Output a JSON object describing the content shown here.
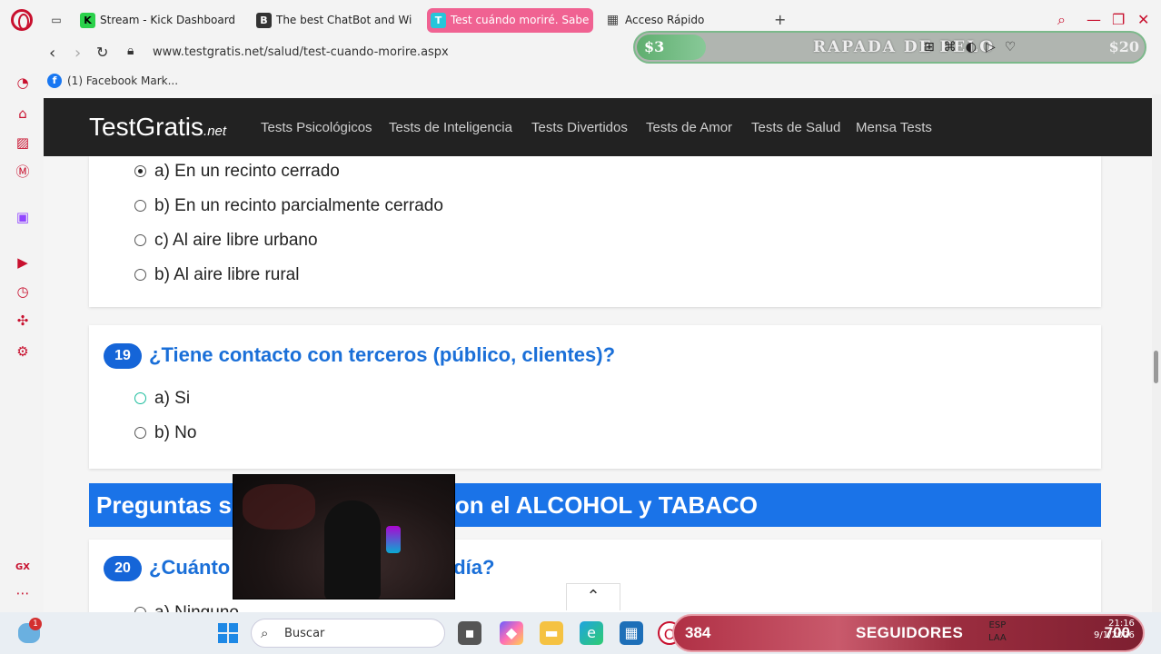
{
  "tabs": [
    {
      "label": "Stream - Kick Dashboard",
      "icon": "K"
    },
    {
      "label": "The best ChatBot and Wid",
      "icon": "B"
    },
    {
      "label": "Test cuándo moriré. Sabe",
      "icon": "T"
    },
    {
      "label": "Acceso Rápido",
      "icon": "grid"
    }
  ],
  "address": {
    "url": "www.testgratis.net/salud/test-cuando-morire.aspx"
  },
  "overlay": {
    "money": "$3",
    "title": "RAPADA DE PELO",
    "amount": "$20"
  },
  "bookmarks": [
    {
      "label": "(1) Facebook Mark..."
    }
  ],
  "site": {
    "brand": "TestGratis",
    "brand_suffix": ".net",
    "nav": [
      "Tests Psicológicos",
      "Tests de Inteligencia",
      "Tests Divertidos",
      "Tests de Amor",
      "Tests de Salud",
      "Mensa Tests"
    ]
  },
  "q18": {
    "options": [
      {
        "text": "a) En un recinto cerrado",
        "checked": true
      },
      {
        "text": "b) En un recinto parcialmente cerrado",
        "checked": false
      },
      {
        "text": "c) Al aire libre urbano",
        "checked": false
      },
      {
        "text": "b) Al aire libre rural",
        "checked": false
      }
    ]
  },
  "q19": {
    "number": "19",
    "question": "¿Tiene contacto con terceros (público, clientes)?",
    "options": [
      {
        "text": "a) Si",
        "checked": false
      },
      {
        "text": "b) No",
        "checked": false
      }
    ]
  },
  "section": {
    "title_start": "Preguntas s",
    "title_end": "on el ALCOHOL y TABACO"
  },
  "q20": {
    "number": "20",
    "question_start": "¿Cuánto",
    "question_end": "día?",
    "option_partial": "a) Ninguno"
  },
  "taskbar": {
    "search_placeholder": "Buscar",
    "tray_badge": "1",
    "followers_count": "384",
    "followers_label": "SEGUIDORES",
    "followers_goal": "700",
    "lang": "ESP",
    "lang2": "LAA",
    "time": "21:16",
    "date": "9/1/2026"
  },
  "colors": {
    "accent": "#1a73e8",
    "opera": "#c8102e",
    "active_tab": "#f06292"
  }
}
